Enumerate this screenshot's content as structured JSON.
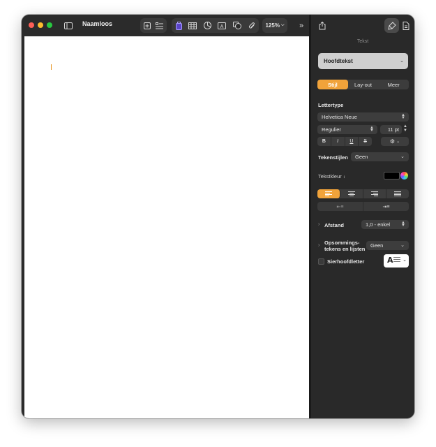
{
  "window": {
    "title": "Naamloos"
  },
  "toolbar": {
    "zoom": "125%"
  },
  "inspector": {
    "title": "Tekst",
    "paragraph_style": "Hoofdtekst",
    "tabs": [
      "Stijl",
      "Lay-out",
      "Meer"
    ],
    "font_section": "Lettertype",
    "font_family": "Helvetica Neue",
    "font_style": "Regulier",
    "font_size": "11 pt",
    "bius": [
      "B",
      "I",
      "U",
      "S"
    ],
    "char_styles_label": "Tekenstijlen",
    "char_styles_value": "Geen",
    "text_color_label": "Tekstkleur",
    "spacing_label": "Afstand",
    "spacing_value": "1,0 - enkel",
    "bullets_label_1": "Opsommings-",
    "bullets_label_2": "tekens en lijsten",
    "bullets_value": "Geen",
    "dropcap_label": "Sierhoofdletter"
  },
  "colors": {
    "accent": "#f1a33a",
    "close": "#ff5f57",
    "minimize": "#febc2e",
    "zoom": "#28c840"
  }
}
